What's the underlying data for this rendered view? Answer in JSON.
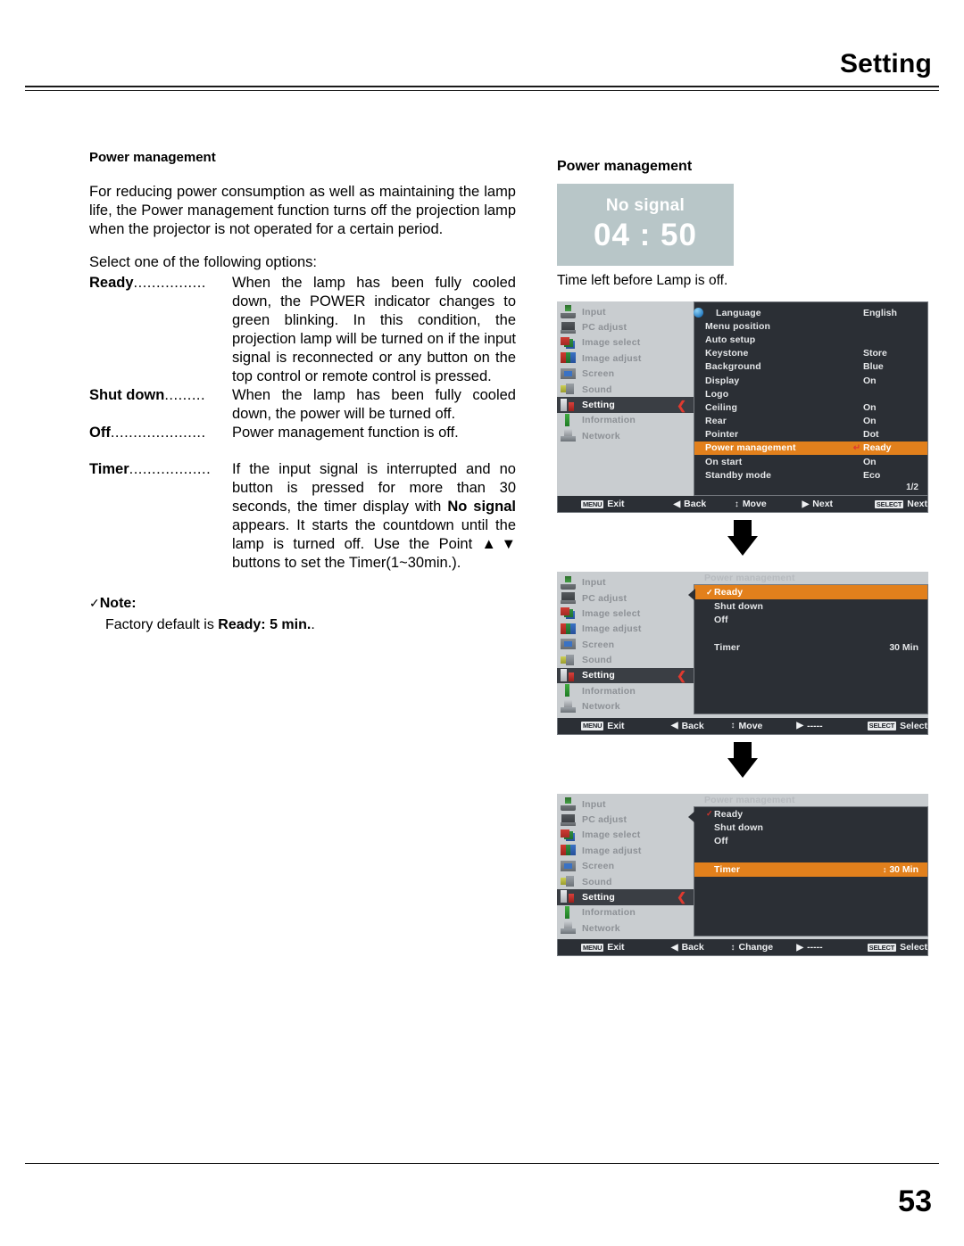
{
  "header": {
    "title": "Setting"
  },
  "footer": {
    "page_number": "53"
  },
  "left": {
    "heading": "Power management",
    "intro": "For reducing power consumption as well as maintaining the lamp life, the Power management function turns off the projection lamp when the projector is not operated for a certain period.",
    "select_line": "Select one of the following options:",
    "definitions": [
      {
        "term": "Ready",
        "dots": "................",
        "desc": "When the lamp has been fully cooled down, the POWER indicator changes to green blinking. In this condition, the projection lamp will be turned on if the input signal is reconnected or any button on the top control or remote control is pressed."
      },
      {
        "term": "Shut down",
        "dots": ".........",
        "desc": "When the lamp has been fully cooled down, the power will be turned off."
      },
      {
        "term": "Off",
        "dots": ".....................",
        "desc": "Power management function is off."
      },
      {
        "term": "Timer",
        "dots": "..................",
        "desc": "If the input signal is interrupted and no button is pressed for more than 30 seconds, the timer display with No signal appears. It starts the countdown until the lamp is turned off. Use the Point ▲▼ buttons to set the Timer(1~30min.)."
      }
    ],
    "note": {
      "tick": "✓",
      "title": "Note:",
      "body": "Factory default is Ready: 5 min.."
    }
  },
  "right": {
    "heading": "Power management",
    "no_signal": {
      "label": "No signal",
      "time": "04 : 50"
    },
    "caption": "Time left before Lamp is off.",
    "sidebar_items": [
      {
        "label": "Input",
        "icon": "input-icon",
        "active": false
      },
      {
        "label": "PC adjust",
        "icon": "pc-adjust-icon",
        "active": false
      },
      {
        "label": "Image select",
        "icon": "image-select-icon",
        "active": false
      },
      {
        "label": "Image adjust",
        "icon": "image-adjust-icon",
        "active": false
      },
      {
        "label": "Screen",
        "icon": "screen-icon",
        "active": false
      },
      {
        "label": "Sound",
        "icon": "sound-icon",
        "active": false
      },
      {
        "label": "Setting",
        "icon": "setting-icon",
        "active": true
      },
      {
        "label": "Information",
        "icon": "information-icon",
        "active": false
      },
      {
        "label": "Network",
        "icon": "network-icon",
        "active": false
      }
    ],
    "menu1": {
      "rows": [
        {
          "label": "Language",
          "value": "English",
          "enter": "",
          "selected": false,
          "globe": true
        },
        {
          "label": "Menu position",
          "value": "",
          "enter": "",
          "selected": false
        },
        {
          "label": "Auto setup",
          "value": "",
          "enter": "",
          "selected": false
        },
        {
          "label": "Keystone",
          "value": "Store",
          "enter": "",
          "selected": false
        },
        {
          "label": "Background",
          "value": "Blue",
          "enter": "",
          "selected": false
        },
        {
          "label": "Display",
          "value": "On",
          "enter": "",
          "selected": false
        },
        {
          "label": "Logo",
          "value": "",
          "enter": "",
          "selected": false
        },
        {
          "label": "Ceiling",
          "value": "On",
          "enter": "",
          "selected": false
        },
        {
          "label": "Rear",
          "value": "On",
          "enter": "",
          "selected": false
        },
        {
          "label": "Pointer",
          "value": "Dot",
          "enter": "",
          "selected": false
        },
        {
          "label": "Power management",
          "value": "Ready",
          "enter": "↵",
          "selected": true
        },
        {
          "label": "On start",
          "value": "On",
          "enter": "",
          "selected": false
        },
        {
          "label": "Standby mode",
          "value": "Eco",
          "enter": "",
          "selected": false
        }
      ],
      "page_indicator": "1/2",
      "guide": [
        {
          "key": "MENU",
          "sym": "",
          "label": "Exit"
        },
        {
          "key": "",
          "sym": "◀",
          "label": "Back"
        },
        {
          "key": "",
          "sym": "↕",
          "label": "Move"
        },
        {
          "key": "",
          "sym": "▶",
          "label": "Next"
        },
        {
          "key": "SELECT",
          "sym": "",
          "label": "Next"
        }
      ]
    },
    "menu2": {
      "title": "Power management",
      "rows": [
        {
          "label": "Ready",
          "value": "",
          "check": "✓",
          "selected": true
        },
        {
          "label": "Shut down",
          "value": "",
          "check": "",
          "selected": false
        },
        {
          "label": "Off",
          "value": "",
          "check": "",
          "selected": false
        }
      ],
      "timer_label": "Timer",
      "timer_value": "30 Min",
      "guide": [
        {
          "key": "MENU",
          "sym": "",
          "label": "Exit"
        },
        {
          "key": "",
          "sym": "◀",
          "label": "Back"
        },
        {
          "key": "",
          "sym": "↕",
          "label": "Move"
        },
        {
          "key": "",
          "sym": "▶",
          "label": "-----"
        },
        {
          "key": "SELECT",
          "sym": "",
          "label": "Select"
        }
      ]
    },
    "menu3": {
      "title": "Power management",
      "rows": [
        {
          "label": "Ready",
          "value": "",
          "check": "✓",
          "selected": false
        },
        {
          "label": "Shut down",
          "value": "",
          "check": "",
          "selected": false
        },
        {
          "label": "Off",
          "value": "",
          "check": "",
          "selected": false
        }
      ],
      "timer_label": "Timer",
      "timer_arrows": "↕",
      "timer_value": "30 Min",
      "guide": [
        {
          "key": "MENU",
          "sym": "",
          "label": "Exit"
        },
        {
          "key": "",
          "sym": "◀",
          "label": "Back"
        },
        {
          "key": "",
          "sym": "↕",
          "label": "Change"
        },
        {
          "key": "",
          "sym": "▶",
          "label": "-----"
        },
        {
          "key": "SELECT",
          "sym": "",
          "label": "Select"
        }
      ]
    }
  },
  "colors": {
    "highlight_orange": "#e2801c",
    "osd_dark": "#2b2f35",
    "sidebar_gray": "#c9cdd0",
    "no_signal_bg": "#b8c6c8",
    "accent_red": "#e03a2f"
  }
}
